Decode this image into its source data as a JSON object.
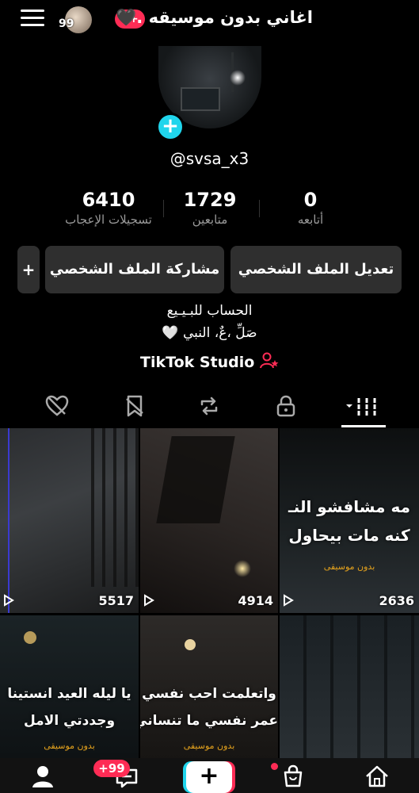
{
  "header": {
    "avatar_count": "99",
    "notif_badge": "9+",
    "title": "اغاني بدون موسيقه .🖤"
  },
  "profile": {
    "username": "@svsa_x3",
    "stats": [
      {
        "num": "6410",
        "label": "تسجيلات الإعجاب"
      },
      {
        "num": "1729",
        "label": "متابعين"
      },
      {
        "num": "0",
        "label": "أتابعه"
      }
    ],
    "buttons": {
      "edit": "تعديل الملف الشخصي",
      "share": "مشاركة الملف الشخصي",
      "add_friend": "+"
    },
    "bio": [
      "الحساب للبـيـيع",
      "صَلِّ ،عٌ، النبي 🤍"
    ],
    "studio": "TikTok Studio"
  },
  "tabs": [
    "videos",
    "private",
    "reposts",
    "favorites",
    "liked"
  ],
  "grid": [
    {
      "count": "5517",
      "text": [],
      "watermark": ""
    },
    {
      "count": "4914",
      "text": [],
      "watermark": ""
    },
    {
      "count": "2636",
      "text": [
        "مه مشافشو النـ",
        "كنه مات بيحاول"
      ],
      "watermark": "بدون موسيقى"
    },
    {
      "count": "",
      "text": [
        "يا ليله العيد انستينا",
        "وجددتي الامل"
      ],
      "watermark": "بدون موسيقى"
    },
    {
      "count": "",
      "text": [
        "واتعلمت احب نفسي",
        "عمر نفسي ما تنساني"
      ],
      "watermark": "بدون موسيقى"
    },
    {
      "count": "",
      "text": [],
      "watermark": ""
    }
  ],
  "bottom_bar": {
    "inbox_badge": "+99",
    "create": "+"
  },
  "colors": {
    "accent_red": "#fe2c55",
    "accent_cyan": "#20d5ec",
    "button_bg": "#2f2f2f",
    "watermark": "#e4a21d"
  }
}
